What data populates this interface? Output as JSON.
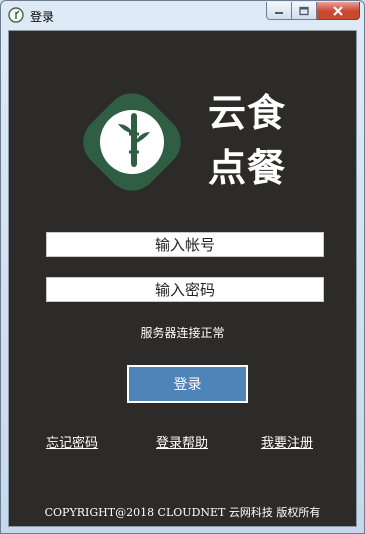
{
  "window": {
    "title": "登录",
    "app_icon": "leaf-icon",
    "controls": [
      "minimize-icon",
      "maximize-icon",
      "close-icon"
    ]
  },
  "brand": {
    "line1": "云食",
    "line2": "点餐",
    "logo_icon": "bamboo-logo",
    "logo_colors": {
      "outer": "#305e45",
      "inner": "#ffffff"
    }
  },
  "form": {
    "username_placeholder": "输入帐号",
    "username_value": "",
    "password_placeholder": "输入密码",
    "password_value": "",
    "status": "服务器连接正常",
    "login_label": "登录"
  },
  "links": {
    "forgot": "忘记密码",
    "help": "登录帮助",
    "register": "我要注册"
  },
  "footer": "COPYRIGHT@2018 CLOUDNET 云网科技 版权所有",
  "colors": {
    "background": "#2c2b29",
    "button": "#4e84b8",
    "text": "#ffffff"
  }
}
